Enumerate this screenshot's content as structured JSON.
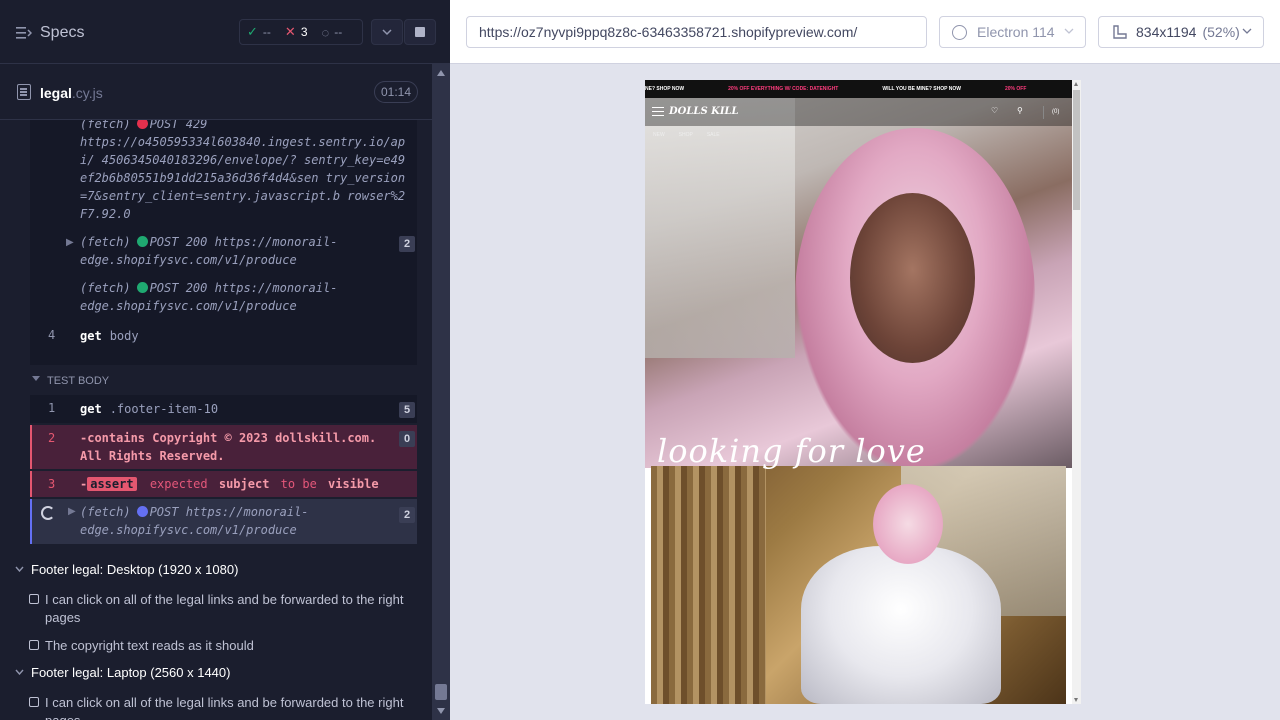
{
  "header": {
    "specs_label": "Specs",
    "stats": {
      "passed": "--",
      "failed": "3",
      "pending": "--"
    }
  },
  "file": {
    "name": "legal",
    "ext": ".cy.js",
    "duration": "01:14"
  },
  "hook_commands": [
    {
      "label": "(fetch)",
      "method": "POST 429",
      "url": "https://o450595334l603840.ingest.sentry.io/api/ 4506345040183296/envelope/? sentry_key=e49ef2b6b80551b91dd215a36d36f4d4&sen try_version=7&sentry_client=sentry.javascript.b rowser%2F7.92.0",
      "status_color": "red"
    },
    {
      "label": "(fetch)",
      "method": "POST 200",
      "url": "https://monorail- edge.shopifysvc.com/v1/produce",
      "status_color": "green",
      "count": "2",
      "expandable": true
    },
    {
      "label": "(fetch)",
      "method": "POST 200",
      "url": "https://monorail- edge.shopifysvc.com/v1/produce",
      "status_color": "green"
    }
  ],
  "hook_get": {
    "num": "4",
    "cmd": "get",
    "arg": "body"
  },
  "test_body": {
    "label": "TEST BODY",
    "get": {
      "num": "1",
      "cmd": "get",
      "arg": ".footer-item-10",
      "count": "5"
    },
    "contains": {
      "num": "2",
      "cmd": "-contains",
      "arg": "Copyright © 2023 dollskill.com.",
      "arg2": "All Rights Reserved.",
      "count": "0"
    },
    "assert": {
      "num": "3",
      "dash": "-",
      "chip": "assert",
      "w1": "expected",
      "w2": "subject",
      "w3": "to be",
      "w4": "visible"
    },
    "pending": {
      "label": "(fetch)",
      "method": "POST https://monorail-",
      "url2": "edge.shopifysvc.com/v1/produce",
      "count": "2"
    }
  },
  "suites": [
    {
      "title": "Footer legal: Desktop (1920 x 1080)",
      "tests": [
        "I can click on all of the legal links and be forwarded to the right pages",
        "The copyright text reads as it should"
      ]
    },
    {
      "title": "Footer legal: Laptop (2560 x 1440)",
      "tests": [
        "I can click on all of the legal links and be forwarded to the right pages"
      ]
    }
  ],
  "aut": {
    "url": "https://oz7nyvpi9ppq8z8c-63463358721.shopifypreview.com/",
    "browser": "Electron 114",
    "viewport": "834x1194",
    "zoom": "(52%)"
  },
  "site": {
    "ticker": [
      "NE? SHOP NOW",
      "20% OFF EVERYTHING W/ CODE: DATENIGHT",
      "WILL YOU BE MINE? SHOP NOW",
      "20% OFF"
    ],
    "logo": "DOLLS KILL",
    "cart": "(0)",
    "subnav": [
      "NEW",
      "SHOP",
      "SALE"
    ],
    "tagline": "looking for love"
  }
}
